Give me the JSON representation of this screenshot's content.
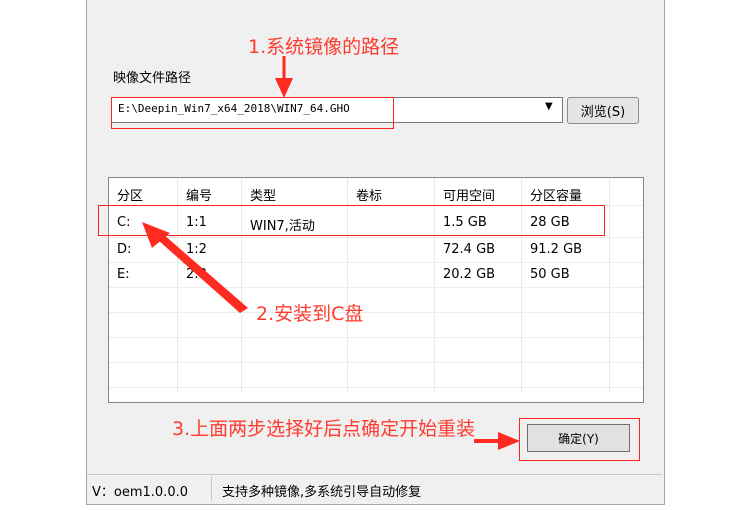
{
  "annotations": {
    "step1": "1.系统镜像的路径",
    "step2": "2.安装到C盘",
    "step3": "3.上面两步选择好后点确定开始重装"
  },
  "image_path": {
    "label": "映像文件路径",
    "value": "E:\\Deepin_Win7_x64_2018\\WIN7_64.GHO",
    "browse_label": "浏览(S)"
  },
  "partition_table": {
    "headers": [
      "分区",
      "编号",
      "类型",
      "卷标",
      "可用空间",
      "分区容量"
    ],
    "rows": [
      [
        "C:",
        "1:1",
        "WIN7,活动",
        "",
        "1.5 GB",
        "28 GB"
      ],
      [
        "D:",
        "1:2",
        "",
        "",
        "72.4 GB",
        "91.2 GB"
      ],
      [
        "E:",
        "2:3",
        "",
        "",
        "20.2 GB",
        "50 GB"
      ]
    ]
  },
  "confirm_button": "确定(Y)",
  "status": {
    "version": "V：oem1.0.0.0",
    "message": "支持多种镜像,多系统引导自动修复"
  },
  "colors": {
    "annotation": "#ff3b2f",
    "window_bg": "#f0f0f0"
  }
}
